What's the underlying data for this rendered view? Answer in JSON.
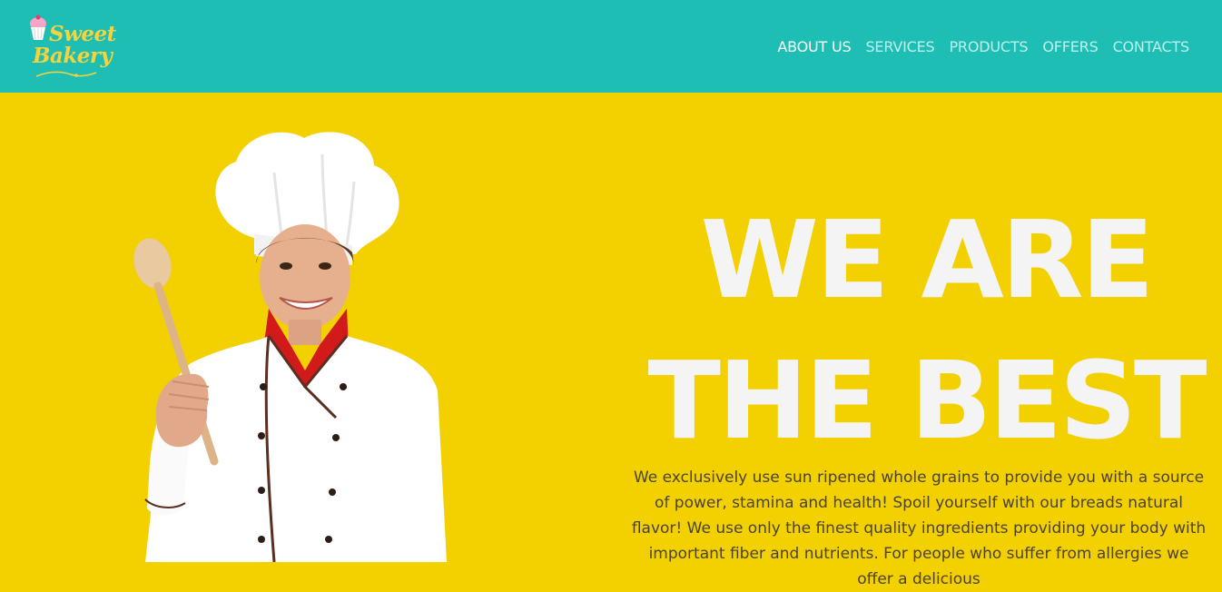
{
  "brand": {
    "logo_line1": "Sweet",
    "logo_line2": "Bakery"
  },
  "nav": {
    "items": [
      {
        "label": "ABOUT US",
        "active": true
      },
      {
        "label": "SERVICES",
        "active": false
      },
      {
        "label": "PRODUCTS",
        "active": false
      },
      {
        "label": "OFFERS",
        "active": false
      },
      {
        "label": "CONTACTS",
        "active": false
      }
    ]
  },
  "hero": {
    "headline_line1": "WE ARE",
    "headline_line2": "THE BEST",
    "body": "We exclusively use sun ripened whole grains to provide you with a source of power, stamina and health! Spoil yourself with our breads natural flavor! We use only the finest quality ingredients providing your body with important fiber and nutrients. For people who suffer from allergies we offer a delicious"
  },
  "colors": {
    "header_bg": "#1fbeb4",
    "hero_bg": "#f3d000",
    "logo_yellow": "#f6d23c",
    "headline_white": "#f4f4f4"
  }
}
